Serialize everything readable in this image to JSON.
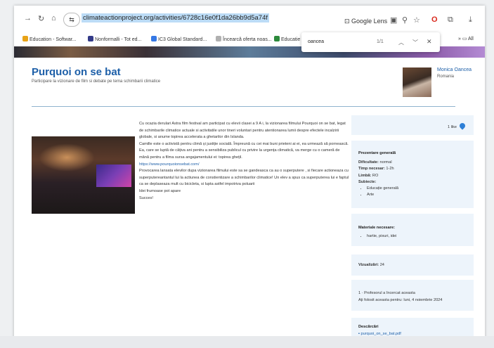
{
  "browser": {
    "url": "climateactionproject.org/activities/6728c16e0f1da26bb9d5a74f",
    "lens_label": "Google Lens",
    "bookmarks": [
      {
        "label": "Education - Softwar...",
        "color": "#e8a317"
      },
      {
        "label": "Nonformalli - Tot ed...",
        "color": "#333a88"
      },
      {
        "label": "IC3 Global Standard...",
        "color": "#3578e5"
      },
      {
        "label": "Încearcă oferta noas...",
        "color": "#b0b0b0"
      },
      {
        "label": "Educatie",
        "color": "#2d8a3c"
      }
    ],
    "bookmarks_all": "All",
    "find": {
      "query": "oancea",
      "count": "1/1"
    }
  },
  "page": {
    "title": "Purquoi on se bat",
    "subtitle": "Participare la vizionare de film si debate pe tema schimbarii climatice",
    "author": "Monica Oancea",
    "country": "Romania",
    "paragraphs": [
      "Cu ocazia derulari Astra film festival am participat cu elevii clasei a 9 A i, la vizionarea filmului Pourquoi on se bat, legat de schimbarile climatice actuale si activitatile unor tineri voluntari pentru atentionarea lumii despre efectele incalzirii globale, si anume topirea accelerata a ghetarilor din Islanda.",
      "Camille este o activistă pentru climă și justiție socială. Împreună cu cei mai buni prieteni ai ei, ea urmează să pornească. Ea, care se luptă de câțiva ani pentru a sensibiliza publicul cu privire la urgența climatică, va merge cu o cameră de mână pentru a filma sursa angajamentului ei: topirea ghețil.",
      "Provocarea lansata elevilor dupa vizionarea filmului este sa se gandeasca ca au o superputere , si fiecare actioneaza cu superputereantantul lui la actiunea de constientizare a schimbarilor climatice! Un elev a spus ca superputerea lui e faptul ca se deplaseaza mult cu bicicleta, si lupta astfel impotriva poluarii",
      "Idei frumoase pot apare",
      "Succes!"
    ],
    "link": "https://www.pourquoionsebat.com/"
  },
  "sidebar": {
    "likes": "1 like",
    "overview": {
      "heading": "Prezentare generală",
      "difficulty_label": "Dificultate:",
      "difficulty": "normal",
      "time_label": "Timp necesar:",
      "time": "1-2h",
      "language_label": "Limbă:",
      "language": "RO",
      "subjects_label": "Subiecte:",
      "subjects": [
        "Educație generală",
        "Arte"
      ]
    },
    "materials": {
      "heading": "Materiale necesare:",
      "items": [
        "hartie, pixuri, idei"
      ]
    },
    "views": {
      "label": "Vizualizări:",
      "value": "24"
    },
    "tried": {
      "line1": "1 · Profesorul a încercat aceasta",
      "line2": "Ați folosit aceasta pentru: luni, 4 noiembrie 2024"
    },
    "downloads": {
      "heading": "Descărcări",
      "file": "purquoi_on_se_bat.pdf"
    }
  }
}
